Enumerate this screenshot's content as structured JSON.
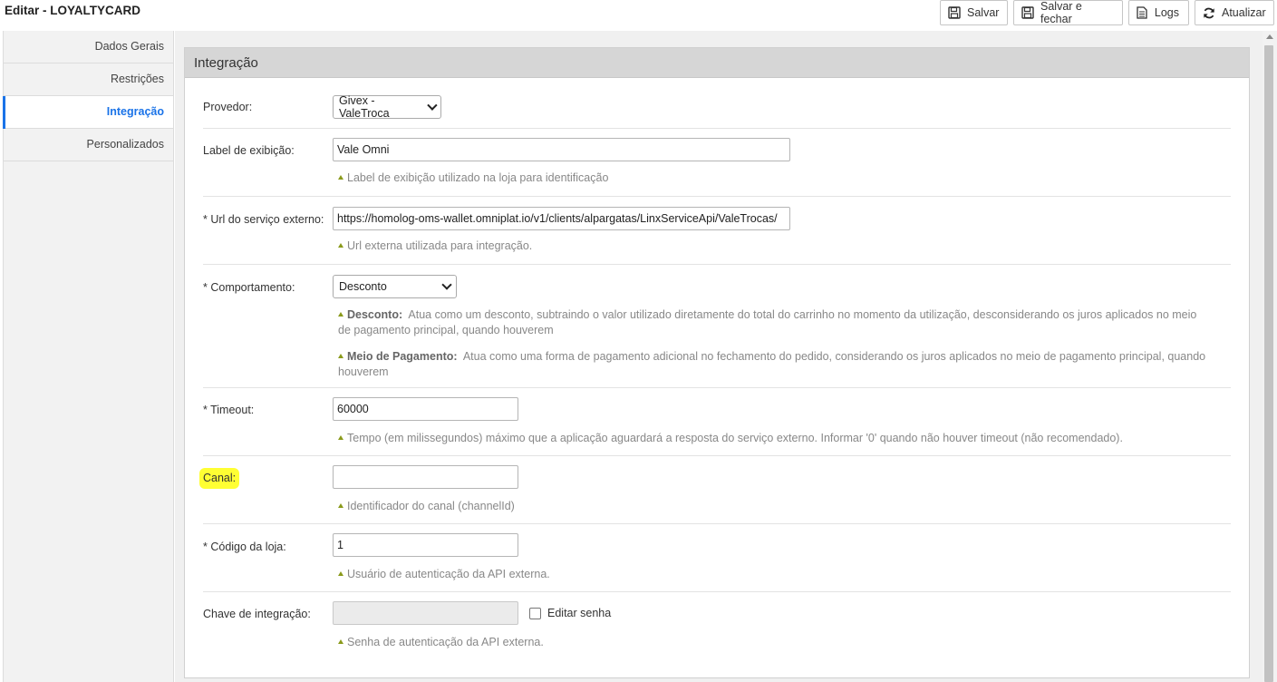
{
  "header": {
    "title": "Editar - LOYALTYCARD",
    "buttons": {
      "save": "Salvar",
      "save_close": "Salvar e fechar",
      "logs": "Logs",
      "refresh": "Atualizar"
    }
  },
  "sidebar": {
    "items": [
      {
        "label": "Dados Gerais"
      },
      {
        "label": "Restrições"
      },
      {
        "label": "Integração"
      },
      {
        "label": "Personalizados"
      }
    ],
    "active_index": 2
  },
  "panel": {
    "title": "Integração",
    "fields": {
      "provider": {
        "label": "Provedor:",
        "value": "Givex - ValeTroca"
      },
      "display_label": {
        "label": "Label de exibição:",
        "value": "Vale Omni",
        "help": "Label de exibição utilizado na loja para identificação"
      },
      "service_url": {
        "label": "* Url do serviço externo:",
        "value": "https://homolog-oms-wallet.omniplat.io/v1/clients/alpargatas/LinxServiceApi/ValeTrocas/",
        "help": "Url externa utilizada para integração."
      },
      "behavior": {
        "label": "* Comportamento:",
        "value": "Desconto",
        "help_items": [
          {
            "term": "Desconto:",
            "text": "Atua como um desconto, subtraindo o valor utilizado diretamente do total do carrinho no momento da utilização, desconsiderando os juros aplicados no meio de pagamento principal, quando houverem"
          },
          {
            "term": "Meio de Pagamento:",
            "text": "Atua como uma forma de pagamento adicional no fechamento do pedido, considerando os juros aplicados no meio de pagamento principal, quando houverem"
          }
        ]
      },
      "timeout": {
        "label": "* Timeout:",
        "value": "60000",
        "help": "Tempo (em milissegundos) máximo que a aplicação aguardará a resposta do serviço externo. Informar '0' quando não houver timeout (não recomendado)."
      },
      "channel": {
        "label": "Canal:",
        "value": "",
        "help": "Identificador do canal (channelId)",
        "highlight_color": "#ffff33"
      },
      "store_code": {
        "label": "* Código da loja:",
        "value": "1",
        "help": "Usuário de autenticação da API externa."
      },
      "integration_key": {
        "label": "Chave de integração:",
        "value": "",
        "checkbox_label": "Editar senha",
        "help": "Senha de autenticação da API externa."
      }
    }
  },
  "colors": {
    "accent": "#1a73e8",
    "help_arrow": "#8a9a1b",
    "panel_header": "#d6d6d6"
  }
}
